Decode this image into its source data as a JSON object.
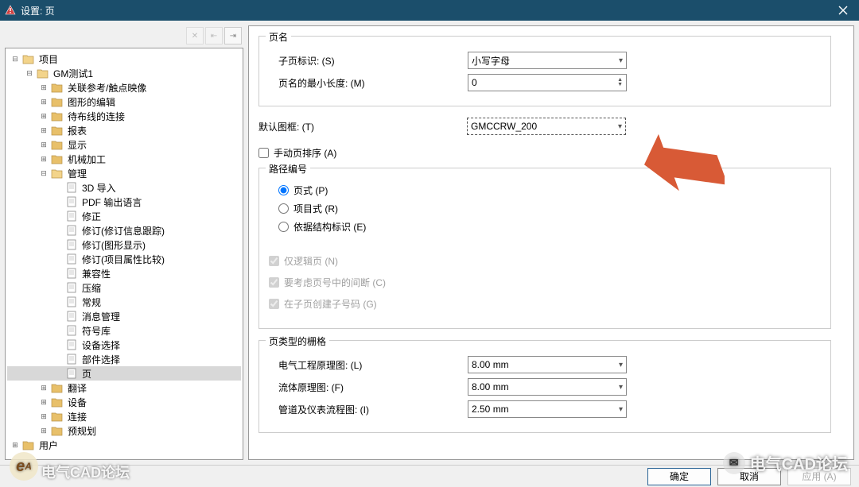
{
  "title": "设置: 页",
  "toolbar": {
    "btn1": "✕",
    "btn2": "⇤",
    "btn3": "⇥"
  },
  "tree": [
    {
      "depth": 0,
      "exp": "⊟",
      "type": "folder-open",
      "label": "项目",
      "sel": false
    },
    {
      "depth": 1,
      "exp": "⊟",
      "type": "folder-open",
      "label": "GM测试1",
      "sel": false
    },
    {
      "depth": 2,
      "exp": "⊞",
      "type": "folder",
      "label": "关联参考/触点映像",
      "sel": false
    },
    {
      "depth": 2,
      "exp": "⊞",
      "type": "folder",
      "label": "图形的编辑",
      "sel": false
    },
    {
      "depth": 2,
      "exp": "⊞",
      "type": "folder",
      "label": "待布线的连接",
      "sel": false
    },
    {
      "depth": 2,
      "exp": "⊞",
      "type": "folder",
      "label": "报表",
      "sel": false
    },
    {
      "depth": 2,
      "exp": "⊞",
      "type": "folder",
      "label": "显示",
      "sel": false
    },
    {
      "depth": 2,
      "exp": "⊞",
      "type": "folder",
      "label": "机械加工",
      "sel": false
    },
    {
      "depth": 2,
      "exp": "⊟",
      "type": "folder-open",
      "label": "管理",
      "sel": false
    },
    {
      "depth": 3,
      "exp": "",
      "type": "page",
      "label": "3D 导入",
      "sel": false
    },
    {
      "depth": 3,
      "exp": "",
      "type": "page",
      "label": "PDF 输出语言",
      "sel": false
    },
    {
      "depth": 3,
      "exp": "",
      "type": "page",
      "label": "修正",
      "sel": false
    },
    {
      "depth": 3,
      "exp": "",
      "type": "page",
      "label": "修订(修订信息跟踪)",
      "sel": false
    },
    {
      "depth": 3,
      "exp": "",
      "type": "page",
      "label": "修订(图形显示)",
      "sel": false
    },
    {
      "depth": 3,
      "exp": "",
      "type": "page",
      "label": "修订(项目属性比较)",
      "sel": false
    },
    {
      "depth": 3,
      "exp": "",
      "type": "page",
      "label": "兼容性",
      "sel": false
    },
    {
      "depth": 3,
      "exp": "",
      "type": "page",
      "label": "压缩",
      "sel": false
    },
    {
      "depth": 3,
      "exp": "",
      "type": "page",
      "label": "常规",
      "sel": false
    },
    {
      "depth": 3,
      "exp": "",
      "type": "page",
      "label": "消息管理",
      "sel": false
    },
    {
      "depth": 3,
      "exp": "",
      "type": "page",
      "label": "符号库",
      "sel": false
    },
    {
      "depth": 3,
      "exp": "",
      "type": "page",
      "label": "设备选择",
      "sel": false
    },
    {
      "depth": 3,
      "exp": "",
      "type": "page",
      "label": "部件选择",
      "sel": false
    },
    {
      "depth": 3,
      "exp": "",
      "type": "page",
      "label": "页",
      "sel": true
    },
    {
      "depth": 2,
      "exp": "⊞",
      "type": "folder",
      "label": "翻译",
      "sel": false
    },
    {
      "depth": 2,
      "exp": "⊞",
      "type": "folder",
      "label": "设备",
      "sel": false
    },
    {
      "depth": 2,
      "exp": "⊞",
      "type": "folder",
      "label": "连接",
      "sel": false
    },
    {
      "depth": 2,
      "exp": "⊞",
      "type": "folder",
      "label": "预规划",
      "sel": false
    },
    {
      "depth": 0,
      "exp": "⊞",
      "type": "folder",
      "label": "用户",
      "sel": false
    }
  ],
  "form": {
    "group_pagename": "页名",
    "subpage_id_label": "子页标识: (S)",
    "subpage_id_value": "小写字母",
    "min_len_label": "页名的最小长度: (M)",
    "min_len_value": "0",
    "default_frame_label": "默认图框: (T)",
    "default_frame_value": "GMCCRW_200",
    "manual_sort_label": "手动页排序 (A)",
    "group_pathnum": "路径编号",
    "radio_page": "页式 (P)",
    "radio_project": "项目式 (R)",
    "radio_struct": "依据结构标识 (E)",
    "cb_only_logic": "仅逻辑页 (N)",
    "cb_gap": "要考虑页号中的间断 (C)",
    "cb_subnum": "在子页创建子号码 (G)",
    "group_grid": "页类型的栅格",
    "grid_elec_label": "电气工程原理图: (L)",
    "grid_elec_value": "8.00 mm",
    "grid_fluid_label": "流体原理图: (F)",
    "grid_fluid_value": "8.00 mm",
    "grid_pipe_label": "管道及仪表流程图: (I)",
    "grid_pipe_value": "2.50 mm"
  },
  "buttons": {
    "ok": "确定",
    "cancel": "取消",
    "apply": "应用 (A)"
  },
  "watermark": {
    "bl": "电气CAD论坛",
    "br": "电气CAD论坛"
  }
}
